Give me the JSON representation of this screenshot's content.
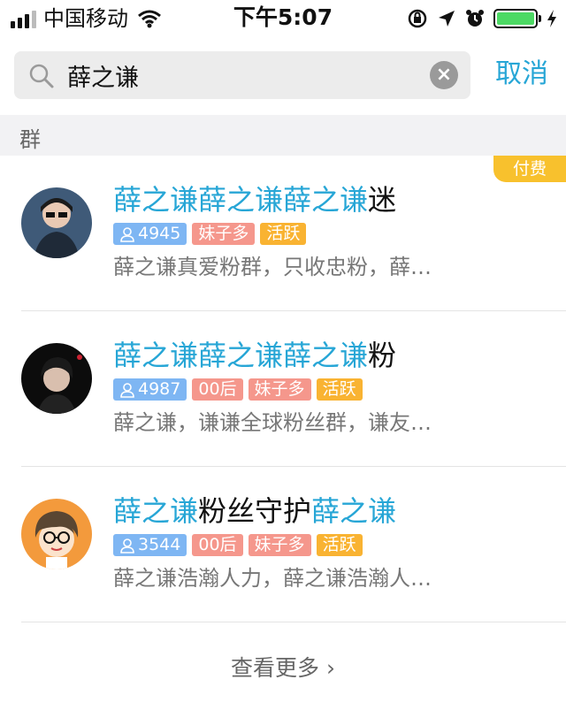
{
  "status": {
    "carrier": "中国移动",
    "time": "下午5:07",
    "battery_color": "#4cd964"
  },
  "search": {
    "query": "薛之谦",
    "cancel_label": "取消"
  },
  "section": {
    "title": "群"
  },
  "groups": [
    {
      "title_parts": [
        {
          "text": "薛之谦薛之谦薛之谦",
          "hl": true
        },
        {
          "text": "迷",
          "hl": false
        }
      ],
      "members": "4945",
      "tags": [
        "妹子多",
        "活跃"
      ],
      "desc": "薛之谦真爱粉群，只收忠粉，薛…",
      "paid_badge": "付费",
      "avatar": "photo-icon"
    },
    {
      "title_parts": [
        {
          "text": "薛之谦薛之谦薛之谦",
          "hl": true
        },
        {
          "text": "粉",
          "hl": false
        }
      ],
      "members": "4987",
      "tags": [
        "00后",
        "妹子多",
        "活跃"
      ],
      "desc": "薛之谦，谦谦全球粉丝群，谦友…",
      "avatar": "photo-icon"
    },
    {
      "title_parts": [
        {
          "text": "薛之谦",
          "hl": true
        },
        {
          "text": "粉丝守护",
          "hl": false
        },
        {
          "text": "薛之谦",
          "hl": true
        }
      ],
      "members": "3544",
      "tags": [
        "00后",
        "妹子多",
        "活跃"
      ],
      "desc": "薛之谦浩瀚人力，薛之谦浩瀚人…",
      "avatar": "cartoon-icon"
    }
  ],
  "more": {
    "label": "查看更多 ›"
  },
  "colors": {
    "accent": "#27a6d6",
    "members_tag": "#7eb6f3",
    "pink_tag": "#f5978c",
    "orange_tag": "#f9b332",
    "paid": "#f8c12d"
  }
}
